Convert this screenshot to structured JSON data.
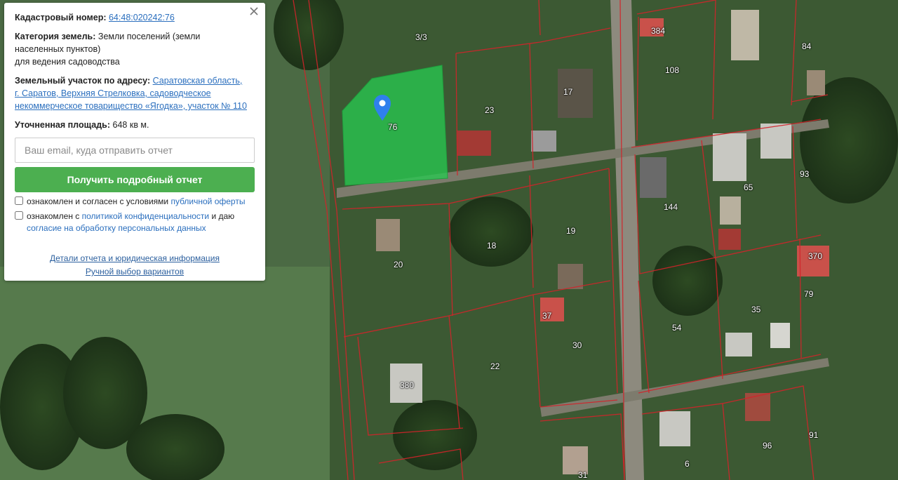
{
  "info_card": {
    "cadastral_label": "Кадастровый номер:",
    "cadastral_value": "64:48:020242:76",
    "category_label": "Категория земель:",
    "category_line1": "Земли поселений (земли",
    "category_line2": "населенных пунктов)",
    "category_line3": "для ведения садоводства",
    "address_label": "Земельный участок по адресу:",
    "address_line1": "Саратовская область,",
    "address_line2": "г. Саратов, Верхняя Стрелковка, садоводческое",
    "address_line3": "некоммерческое товарищество «Ягодка», участок № 110",
    "area_label": "Уточненная площадь:",
    "area_value": "648 кв м.",
    "email_placeholder": "Ваш email, куда отправить отчет",
    "submit_label": "Получить подробный отчет",
    "consent1_text": "ознакомлен и согласен с условиями",
    "consent1_link": "публичной оферты",
    "consent2_text": "ознакомлен с",
    "consent2_link1": "политикой конфиденциальности",
    "consent2_mid": "и даю",
    "consent2_link2": "согласие на обработку персональных данных",
    "details_link": "Детали отчета и юридическая информация",
    "manual_link": "Ручной выбор вариантов"
  },
  "map": {
    "plot_labels": [
      "3/3",
      "76",
      "23",
      "17",
      "384",
      "108",
      "84",
      "93",
      "65",
      "144",
      "19",
      "18",
      "20",
      "370",
      "79",
      "35",
      "54",
      "37",
      "30",
      "22",
      "380",
      "96",
      "6",
      "31",
      "91"
    ],
    "highlight_color": "#28c850",
    "boundary_color": "#d2232a",
    "marker_color": "#2f80ed"
  },
  "icons": {
    "close": "close-icon",
    "marker": "map-pin-icon"
  }
}
